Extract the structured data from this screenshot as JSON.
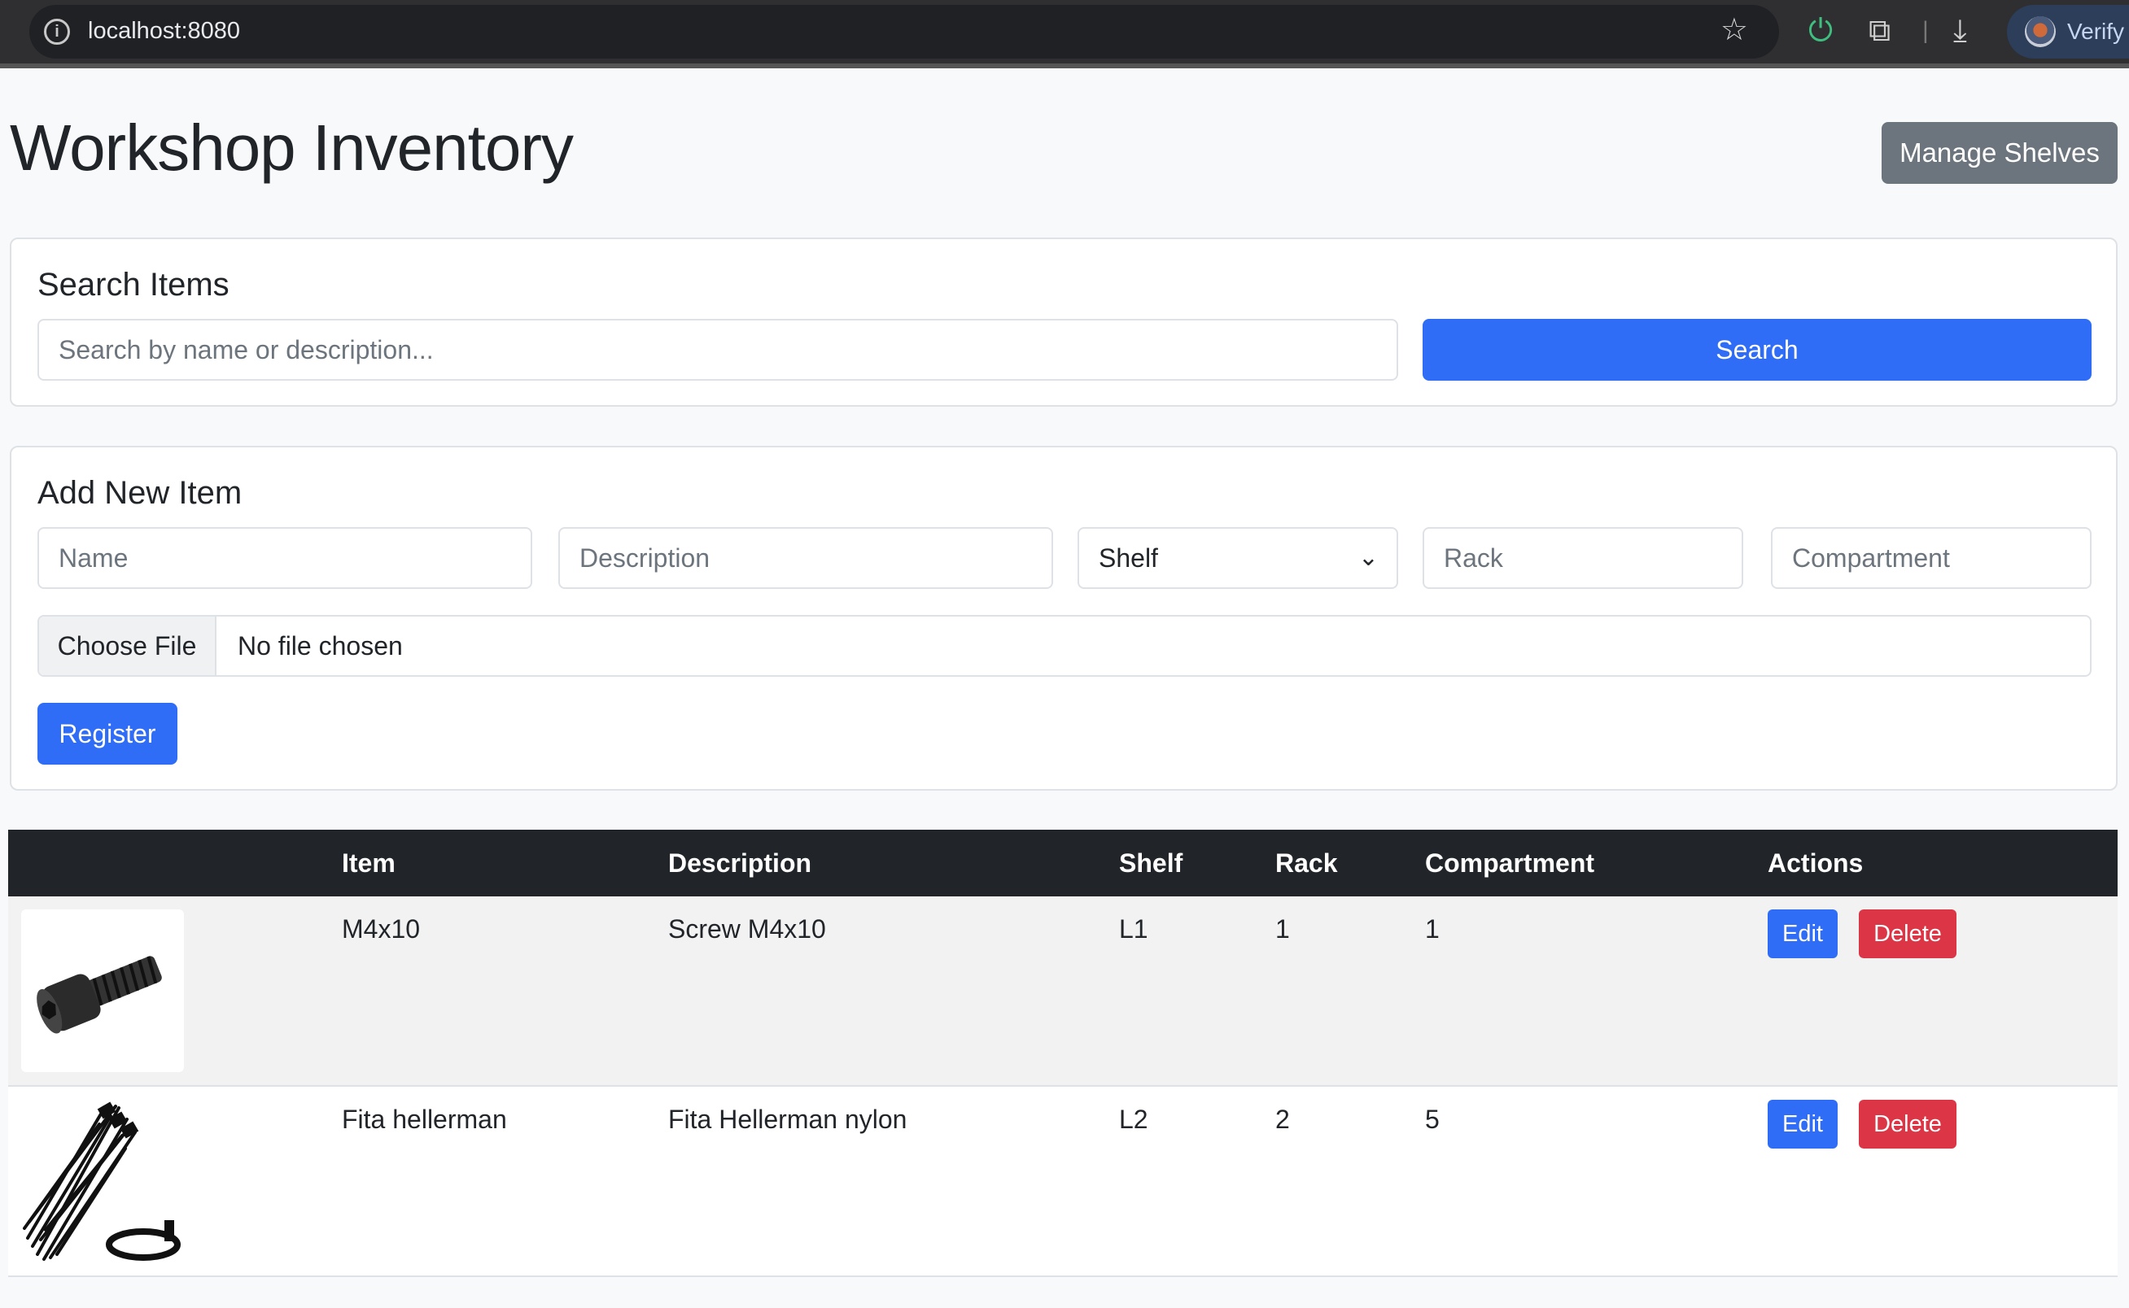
{
  "browser": {
    "url": "localhost:8080",
    "profile_label": "Verify"
  },
  "page": {
    "title": "Workshop Inventory",
    "manage_shelves_label": "Manage Shelves"
  },
  "search": {
    "title": "Search Items",
    "placeholder": "Search by name or description...",
    "button_label": "Search"
  },
  "add_item": {
    "title": "Add New Item",
    "name_placeholder": "Name",
    "description_placeholder": "Description",
    "shelf_selected": "Shelf",
    "rack_placeholder": "Rack",
    "compartment_placeholder": "Compartment",
    "file_button_label": "Choose File",
    "file_status": "No file chosen",
    "register_label": "Register"
  },
  "table": {
    "columns": [
      "",
      "Item",
      "Description",
      "Shelf",
      "Rack",
      "Compartment",
      "Actions"
    ],
    "rows": [
      {
        "image": "screw-image",
        "item": "M4x10",
        "description": "Screw M4x10",
        "shelf": "L1",
        "rack": "1",
        "compartment": "1",
        "edit_label": "Edit",
        "delete_label": "Delete"
      },
      {
        "image": "cable-ties-image",
        "item": "Fita hellerman",
        "description": "Fita Hellerman nylon",
        "shelf": "L2",
        "rack": "2",
        "compartment": "5",
        "edit_label": "Edit",
        "delete_label": "Delete"
      }
    ]
  },
  "colors": {
    "primary": "#2f6df6",
    "secondary": "#6c757d",
    "danger": "#dc3545",
    "table_header": "#212529"
  }
}
